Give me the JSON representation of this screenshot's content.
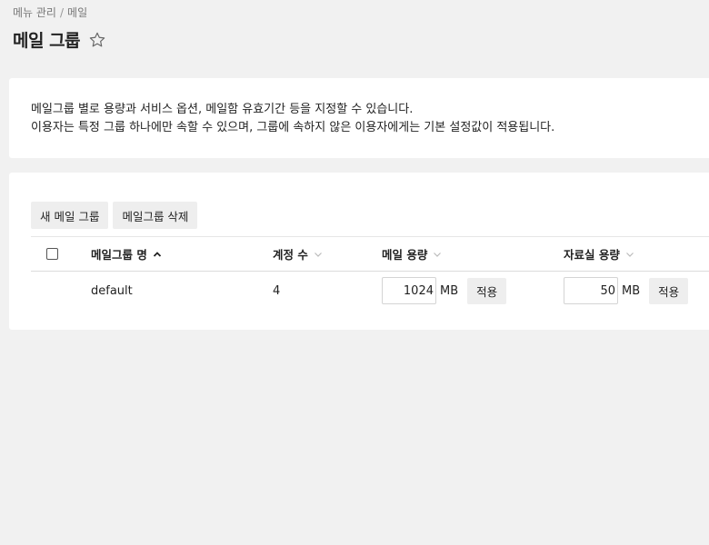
{
  "breadcrumb": {
    "parent": "메뉴 관리",
    "separator": "/",
    "current": "메일"
  },
  "page": {
    "title": "메일 그룹"
  },
  "description": {
    "line1": "메일그룹 별로 용량과 서비스 옵션, 메일함 유효기간 등을 지정할 수 있습니다.",
    "line2": "이용자는 특정 그룹 하나에만 속할 수 있으며, 그룹에 속하지 않은 이용자에게는 기본 설정값이 적용됩니다."
  },
  "toolbar": {
    "new_group_label": "새 메일 그룹",
    "delete_group_label": "메일그룹 삭제"
  },
  "table": {
    "columns": {
      "name": "메일그룹 명",
      "accounts": "계정 수",
      "mail_quota": "메일 용량",
      "drive_quota": "자료실 용량"
    },
    "rows": [
      {
        "name": "default",
        "accounts": "4",
        "mail_quota": "1024",
        "mail_unit": "MB",
        "drive_quota": "50",
        "drive_unit": "MB",
        "apply_label": "적용"
      }
    ]
  },
  "icons": {
    "favorite": "star-outline-icon",
    "sort_asc": "chevron-up-icon",
    "sort": "chevron-down-icon"
  }
}
